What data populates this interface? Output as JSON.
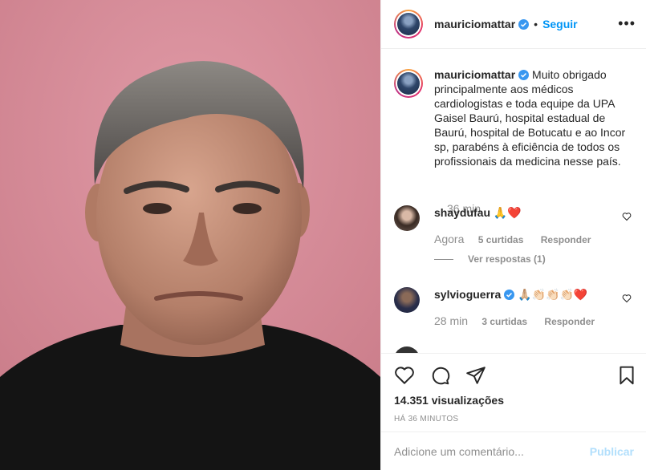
{
  "post": {
    "author": "mauriciomattar",
    "follow_label": "Seguir",
    "separator": "•",
    "more_label": "•••"
  },
  "caption": {
    "username": "mauriciomattar",
    "text": "Muito obrigado principalmente aos médicos cardiologistas e toda equipe da UPA Gaisel Baurú, hospital estadual de Baurú, hospital de Botucatu e ao Incor sp, parabéns à eficiência de todos os profissionais da medicina nesse país.",
    "time": "36 min"
  },
  "comments": [
    {
      "username": "shaydufau",
      "text": "🙏❤️",
      "time": "Agora",
      "likes": "5 curtidas",
      "reply": "Responder",
      "view_replies": "Ver respostas (1)"
    },
    {
      "username": "sylvioguerra",
      "text": "🙏🏼👏🏻👏🏻👏🏻❤️",
      "time": "28 min",
      "likes": "3 curtidas",
      "reply": "Responder"
    }
  ],
  "stats": {
    "views": "14.351 visualizações",
    "posted_ago": "HÁ 36 MINUTOS"
  },
  "add_comment": {
    "placeholder": "Adicione um comentário...",
    "post_label": "Publicar"
  },
  "colors": {
    "accent": "#0095f6",
    "verified": "#3897f0",
    "muted": "#8e8e8e",
    "wall": "#d58a96"
  },
  "icons": [
    "verified-icon",
    "more-options-icon",
    "heart-icon",
    "comment-icon",
    "share-icon",
    "bookmark-icon"
  ]
}
